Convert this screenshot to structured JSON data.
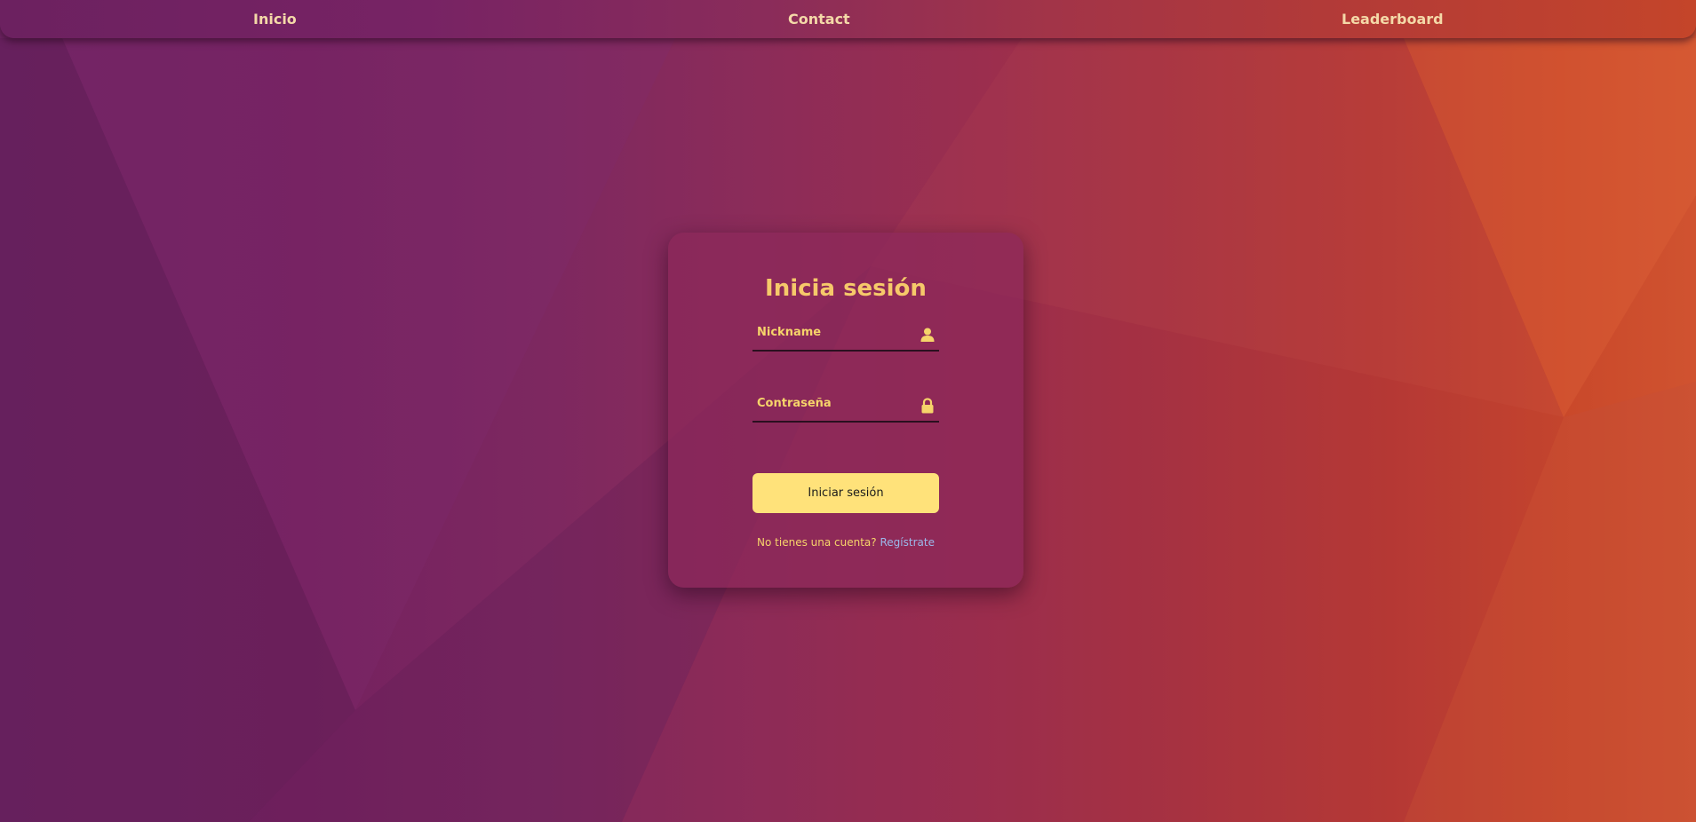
{
  "navbar": {
    "links": [
      {
        "label": "Inicio"
      },
      {
        "label": "Contact"
      },
      {
        "label": "Leaderboard"
      }
    ]
  },
  "login": {
    "title": "Inicia sesión",
    "nickname_placeholder": "Nickname",
    "nickname_icon": "user-icon",
    "password_placeholder": "Contraseña",
    "password_icon": "lock-icon",
    "submit_label": "Iniciar sesión",
    "register_prompt": "No tienes una cuenta?",
    "register_link": "Regístrate"
  },
  "colors": {
    "accent_yellow": "#ffe27a",
    "title_gold": "#f6c96a",
    "link_blue": "#9bb8ea",
    "background_left": "#6e2363",
    "background_right": "#d05330"
  }
}
